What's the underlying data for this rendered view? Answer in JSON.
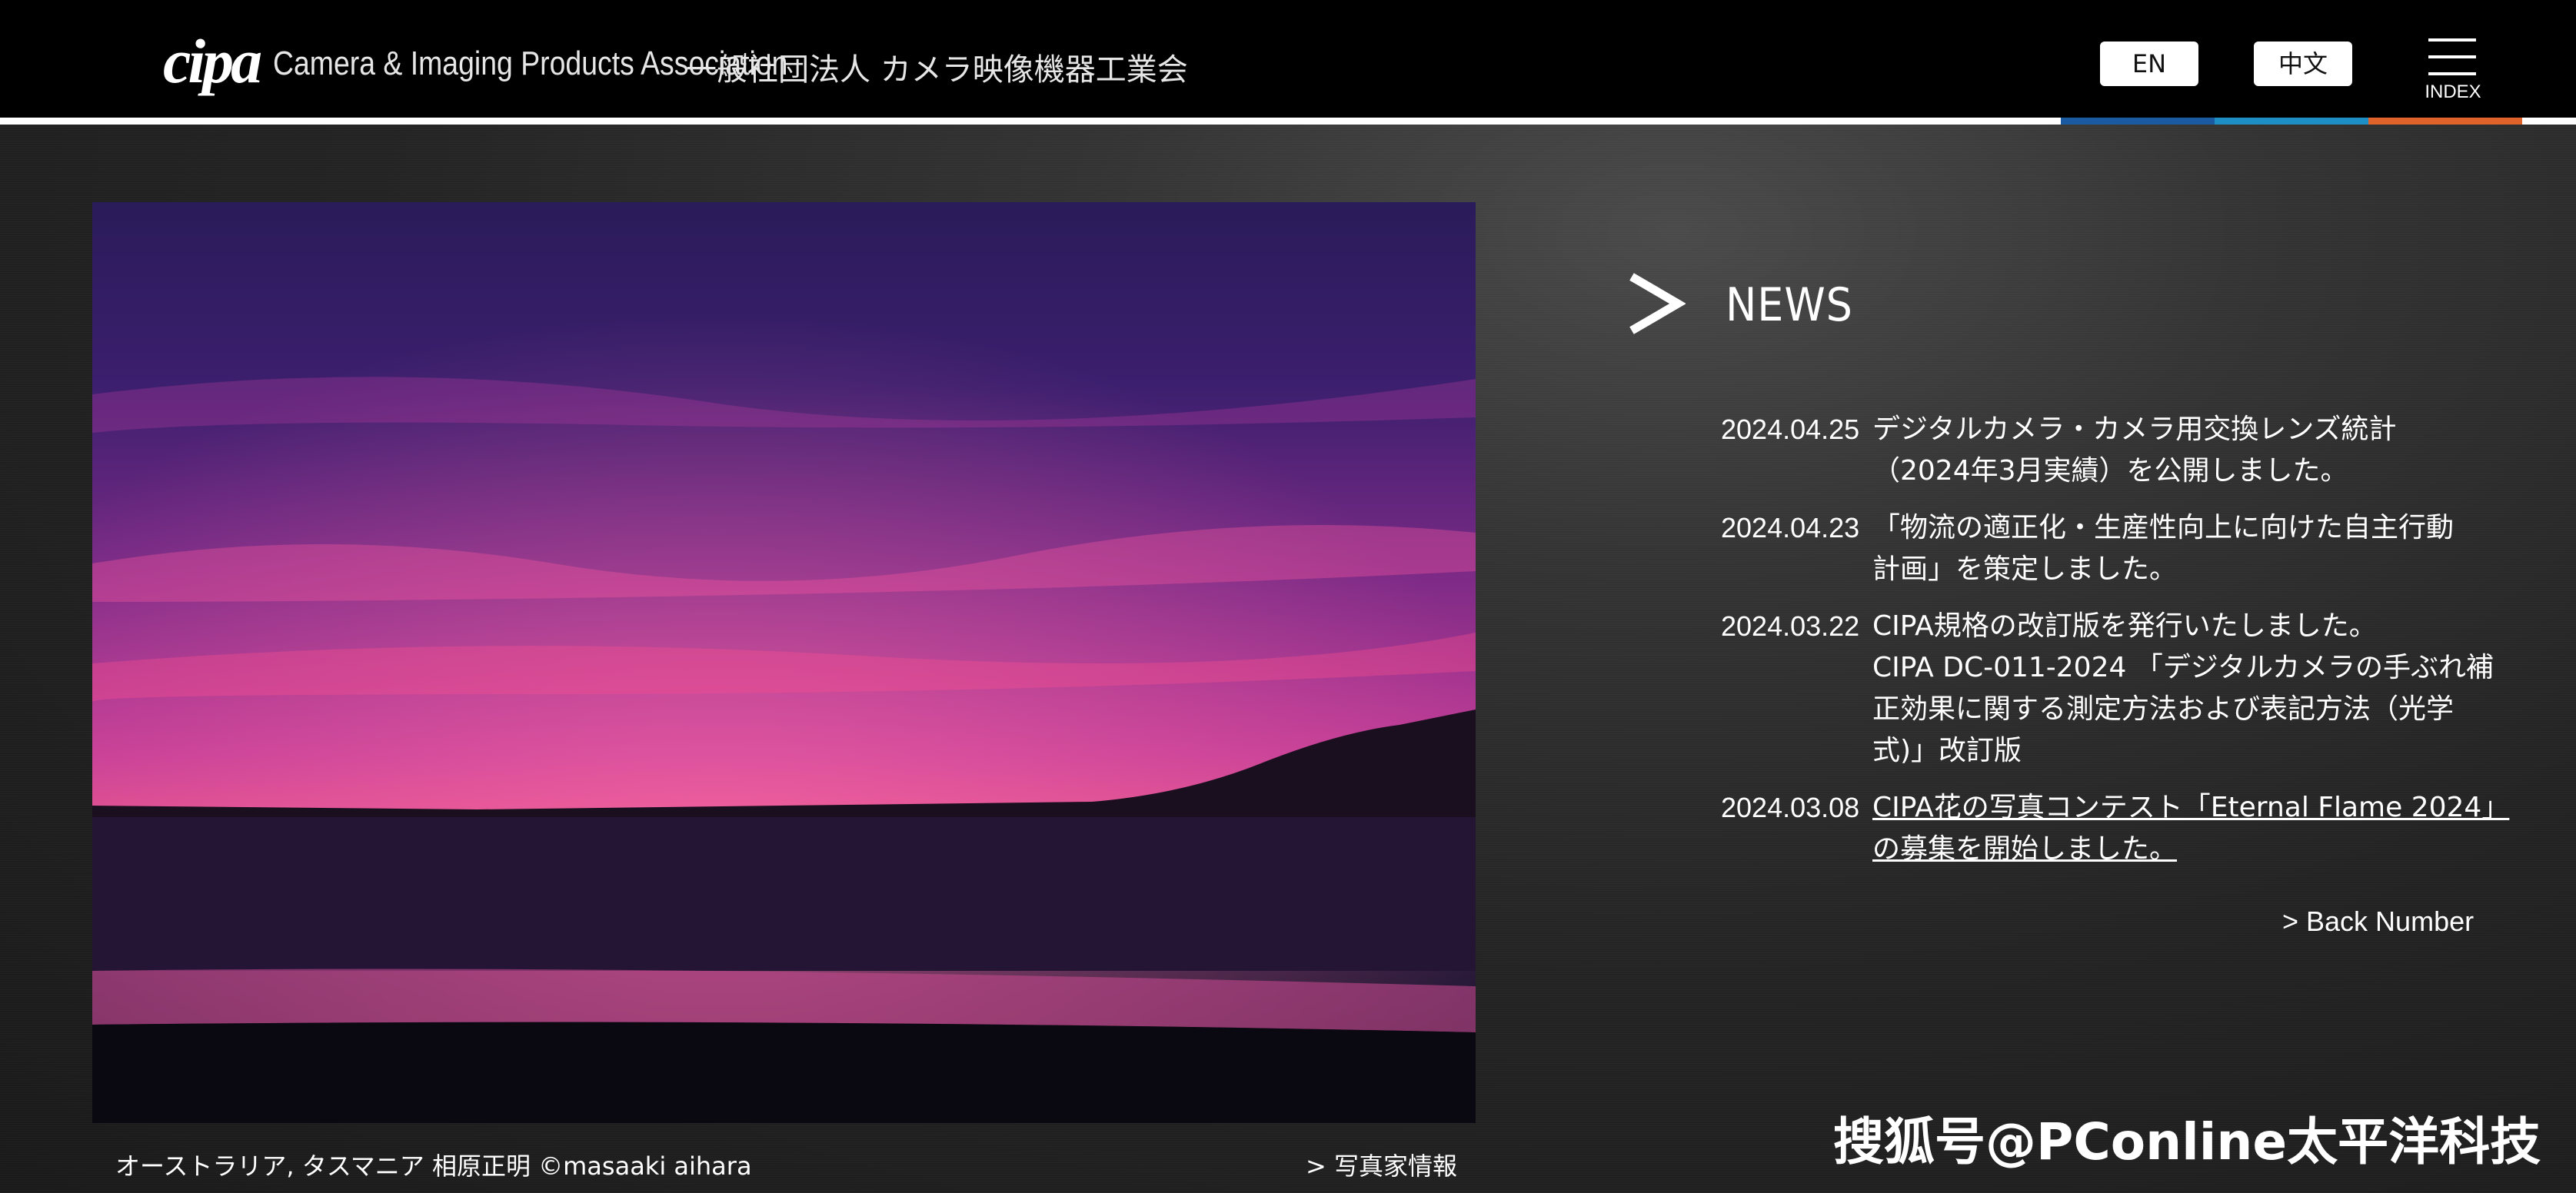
{
  "header": {
    "logo_mark": "cipa",
    "org_name_en": "Camera & Imaging Products Association",
    "org_name_jp": "一般社団法人 カメラ映像機器工業会",
    "lang_buttons": [
      "EN",
      "中文"
    ],
    "menu_label": "INDEX",
    "accent_colors": [
      "#1a5aa0",
      "#1e8fc4",
      "#e0642a"
    ]
  },
  "photo": {
    "caption": "オーストラリア, タスマニア  相原正明 ©masaaki aihara",
    "photographer_link": "> 写真家情報"
  },
  "news": {
    "title": "NEWS",
    "items": [
      {
        "date": "2024.04.25",
        "lines": [
          "デジタルカメラ・カメラ用交換レンズ統計",
          "（2024年3月実績）を公開しました。"
        ],
        "link": false
      },
      {
        "date": "2024.04.23",
        "lines": [
          "「物流の適正化・生産性向上に向けた自主行動",
          "計画」を策定しました。"
        ],
        "link": false
      },
      {
        "date": "2024.03.22",
        "lines": [
          "CIPA規格の改訂版を発行いたしました。",
          "CIPA DC-011-2024 「デジタルカメラの手ぶれ補",
          "正効果に関する測定方法および表記方法（光学",
          "式)」改訂版"
        ],
        "link": false
      },
      {
        "date": "2024.03.08",
        "lines": [
          "CIPA花の写真コンテスト「Eternal Flame 2024」",
          "の募集を開始しました。"
        ],
        "link": true
      }
    ],
    "back_number": "> Back Number"
  },
  "watermark": "搜狐号@PConline太平洋科技"
}
